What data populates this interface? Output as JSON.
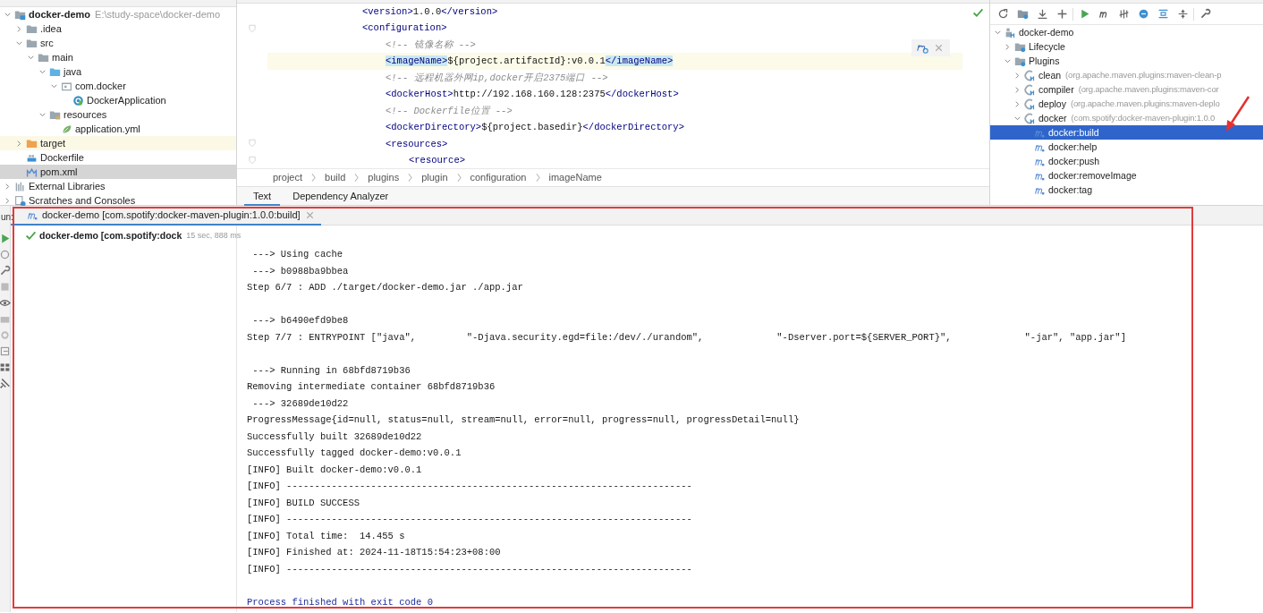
{
  "project_tree": [
    {
      "label": "docker-demo",
      "detail": "E:\\study-space\\docker-demo",
      "kind": "module",
      "expanded": true,
      "selected": false,
      "children": [
        {
          "label": ".idea",
          "kind": "folder",
          "expanded": false,
          "selected": false
        },
        {
          "label": "src",
          "kind": "folder",
          "expanded": true,
          "selected": false,
          "children": [
            {
              "label": "main",
              "kind": "folder",
              "expanded": true,
              "selected": false,
              "children": [
                {
                  "label": "java",
                  "kind": "source-folder",
                  "expanded": true,
                  "selected": false,
                  "children": [
                    {
                      "label": "com.docker",
                      "kind": "package",
                      "expanded": true,
                      "selected": false,
                      "children": [
                        {
                          "label": "DockerApplication",
                          "kind": "class",
                          "selected": false
                        }
                      ]
                    }
                  ]
                },
                {
                  "label": "resources",
                  "kind": "resources-folder",
                  "expanded": true,
                  "selected": false,
                  "children": [
                    {
                      "label": "application.yml",
                      "kind": "yaml",
                      "selected": false
                    }
                  ]
                }
              ]
            }
          ]
        },
        {
          "label": "target",
          "kind": "excluded-folder",
          "expanded": false,
          "selected": false
        },
        {
          "label": "Dockerfile",
          "kind": "docker",
          "selected": false
        },
        {
          "label": "pom.xml",
          "kind": "maven",
          "selected": true
        }
      ]
    },
    {
      "label": "External Libraries",
      "kind": "libraries",
      "expanded": false,
      "selected": false
    },
    {
      "label": "Scratches and Consoles",
      "kind": "scratches",
      "expanded": false,
      "selected": false
    }
  ],
  "editor": {
    "lines": [
      {
        "current": false,
        "folded": false,
        "segments": [
          {
            "kind": "tag",
            "text": "<version>"
          },
          {
            "kind": "text",
            "text": "1.0.0"
          },
          {
            "kind": "tag",
            "text": "</version>"
          }
        ]
      },
      {
        "current": false,
        "folded": true,
        "segments": [
          {
            "kind": "tag",
            "text": "<configuration>"
          }
        ],
        "children": [
          {
            "current": false,
            "folded": false,
            "segments": [
              {
                "kind": "comment",
                "text": "<!-- 镜像名称 -->"
              }
            ]
          },
          {
            "current": true,
            "folded": false,
            "segments": [
              {
                "kind": "tag-match",
                "text": "<imageName>"
              },
              {
                "kind": "text",
                "text": "${project.artifactId}:v0.0.1"
              },
              {
                "kind": "tag-match",
                "text": "</imageName>"
              }
            ]
          },
          {
            "current": false,
            "folded": false,
            "segments": [
              {
                "kind": "comment",
                "text": "<!-- 远程机器外网ip,docker开启2375端口 -->"
              }
            ]
          },
          {
            "current": false,
            "folded": false,
            "segments": [
              {
                "kind": "tag",
                "text": "<dockerHost>"
              },
              {
                "kind": "text",
                "text": "http://192.168.160.128:2375"
              },
              {
                "kind": "tag",
                "text": "</dockerHost>"
              }
            ]
          },
          {
            "current": false,
            "folded": false,
            "segments": [
              {
                "kind": "comment",
                "text": "<!-- Dockerfile位置 -->"
              }
            ]
          },
          {
            "current": false,
            "folded": false,
            "segments": [
              {
                "kind": "tag",
                "text": "<dockerDirectory>"
              },
              {
                "kind": "text",
                "text": "${project.basedir}"
              },
              {
                "kind": "tag",
                "text": "</dockerDirectory>"
              }
            ]
          },
          {
            "current": false,
            "folded": true,
            "segments": [
              {
                "kind": "tag",
                "text": "<resources>"
              }
            ],
            "children": [
              {
                "current": false,
                "folded": true,
                "segments": [
                  {
                    "kind": "tag",
                    "text": "<resource>"
                  }
                ]
              }
            ]
          }
        ]
      }
    ],
    "breadcrumbs": [
      "project",
      "build",
      "plugins",
      "plugin",
      "configuration",
      "imageName"
    ],
    "tabs": [
      {
        "label": "Text",
        "selected": true
      },
      {
        "label": "Dependency Analyzer",
        "selected": false
      }
    ]
  },
  "maven_tree": [
    {
      "label": "docker-demo",
      "kind": "maven-project",
      "expanded": true,
      "selected": false,
      "children": [
        {
          "label": "Lifecycle",
          "kind": "config-folder",
          "expanded": false,
          "selected": false
        },
        {
          "label": "Plugins",
          "kind": "config-folder",
          "expanded": true,
          "selected": false,
          "children": [
            {
              "label": "clean",
              "detail": "(org.apache.maven.plugins:maven-clean-p",
              "kind": "plugin",
              "expanded": false,
              "selected": false
            },
            {
              "label": "compiler",
              "detail": "(org.apache.maven.plugins:maven-cor",
              "kind": "plugin",
              "expanded": false,
              "selected": false
            },
            {
              "label": "deploy",
              "detail": "(org.apache.maven.plugins:maven-deplo",
              "kind": "plugin",
              "expanded": false,
              "selected": false
            },
            {
              "label": "docker",
              "detail": "(com.spotify:docker-maven-plugin:1.0.0",
              "kind": "plugin",
              "expanded": true,
              "selected": false,
              "children": [
                {
                  "label": "docker:build",
                  "kind": "goal",
                  "selected": true
                },
                {
                  "label": "docker:help",
                  "kind": "goal",
                  "selected": false
                },
                {
                  "label": "docker:push",
                  "kind": "goal",
                  "selected": false
                },
                {
                  "label": "docker:removeImage",
                  "kind": "goal",
                  "selected": false
                },
                {
                  "label": "docker:tag",
                  "kind": "goal",
                  "selected": false
                }
              ]
            }
          ]
        }
      ]
    }
  ],
  "run": {
    "label": "un:",
    "tab": "docker-demo [com.spotify:docker-maven-plugin:1.0.0:build]",
    "item": {
      "label": "docker-demo [com.spotify:dock",
      "time": "15 sec, 888 ms",
      "success": true
    },
    "console": [
      {
        "text": " ---> Using cache",
        "kind": "output",
        "blank_before": false
      },
      {
        "text": " ---> b0988ba9bbea",
        "kind": "output",
        "blank_before": false
      },
      {
        "text": "Step 6/7 : ADD ./target/docker-demo.jar ./app.jar",
        "kind": "output",
        "blank_before": false
      },
      {
        "text": " ---> b6490efd9be8",
        "kind": "output",
        "blank_before": true
      },
      {
        "text": "Step 7/7 : ENTRYPOINT [\"java\",         \"-Djava.security.egd=file:/dev/./urandom\",             \"-Dserver.port=${SERVER_PORT}\",             \"-jar\", \"app.jar\"]",
        "kind": "output",
        "blank_before": false
      },
      {
        "text": " ---> Running in 68bfd8719b36",
        "kind": "output",
        "blank_before": true
      },
      {
        "text": "Removing intermediate container 68bfd8719b36",
        "kind": "output",
        "blank_before": false
      },
      {
        "text": " ---> 32689de10d22",
        "kind": "output",
        "blank_before": false
      },
      {
        "text": "ProgressMessage{id=null, status=null, stream=null, error=null, progress=null, progressDetail=null}",
        "kind": "output",
        "blank_before": false
      },
      {
        "text": "Successfully built 32689de10d22",
        "kind": "output",
        "blank_before": false
      },
      {
        "text": "Successfully tagged docker-demo:v0.0.1",
        "kind": "output",
        "blank_before": false
      },
      {
        "text": "[INFO] Built docker-demo:v0.0.1",
        "kind": "output",
        "blank_before": false
      },
      {
        "text": "[INFO] ------------------------------------------------------------------------",
        "kind": "output",
        "blank_before": false
      },
      {
        "text": "[INFO] BUILD SUCCESS",
        "kind": "output",
        "blank_before": false
      },
      {
        "text": "[INFO] ------------------------------------------------------------------------",
        "kind": "output",
        "blank_before": false
      },
      {
        "text": "[INFO] Total time:  14.455 s",
        "kind": "output",
        "blank_before": false
      },
      {
        "text": "[INFO] Finished at: 2024-11-18T15:54:23+08:00",
        "kind": "output",
        "blank_before": false
      },
      {
        "text": "[INFO] ------------------------------------------------------------------------",
        "kind": "output",
        "blank_before": false
      },
      {
        "text": "Process finished with exit code 0",
        "kind": "system",
        "blank_before": true
      }
    ]
  }
}
